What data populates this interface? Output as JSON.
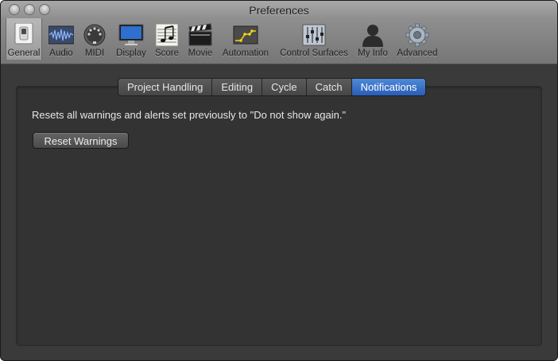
{
  "window": {
    "title": "Preferences"
  },
  "toolbar": {
    "items": [
      {
        "label": "General",
        "icon": "general-switch-icon",
        "selected": true
      },
      {
        "label": "Audio",
        "icon": "audio-waveform-icon"
      },
      {
        "label": "MIDI",
        "icon": "midi-connector-icon"
      },
      {
        "label": "Display",
        "icon": "display-monitor-icon"
      },
      {
        "label": "Score",
        "icon": "score-notes-icon"
      },
      {
        "label": "Movie",
        "icon": "movie-clapper-icon"
      },
      {
        "label": "Automation",
        "icon": "automation-curve-icon"
      },
      {
        "label": "Control Surfaces",
        "icon": "control-surfaces-faders-icon"
      },
      {
        "label": "My Info",
        "icon": "user-silhouette-icon"
      },
      {
        "label": "Advanced",
        "icon": "advanced-gear-icon"
      }
    ]
  },
  "tabs": [
    {
      "label": "Project Handling"
    },
    {
      "label": "Editing"
    },
    {
      "label": "Cycle"
    },
    {
      "label": "Catch"
    },
    {
      "label": "Notifications",
      "selected": true
    }
  ],
  "notifications": {
    "description": "Resets all warnings and alerts set previously to \"Do not show again.\"",
    "reset_button_label": "Reset Warnings"
  },
  "colors": {
    "accent": "#2f66c4",
    "panel_background": "#333333",
    "window_background": "#3a3a3a",
    "text": "#e6e6e6"
  }
}
